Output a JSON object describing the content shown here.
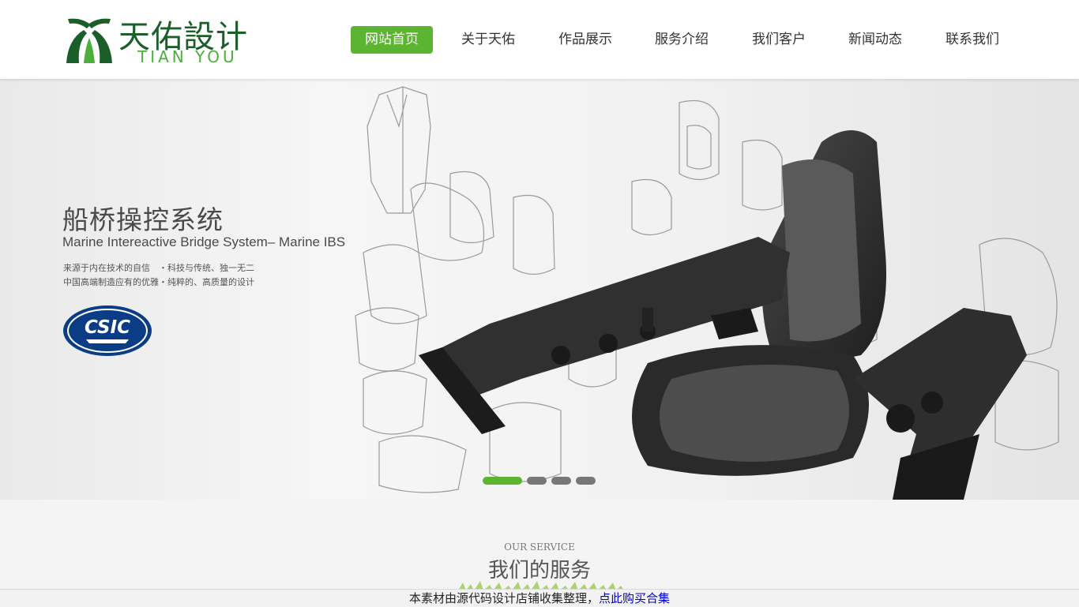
{
  "header": {
    "logo": {
      "cn": "天佑設计",
      "en": "TIAN YOU"
    },
    "nav": [
      {
        "label": "网站首页",
        "active": true
      },
      {
        "label": "关于天佑",
        "active": false
      },
      {
        "label": "作品展示",
        "active": false
      },
      {
        "label": "服务介绍",
        "active": false
      },
      {
        "label": "我们客户",
        "active": false
      },
      {
        "label": "新闻动态",
        "active": false
      },
      {
        "label": "联系我们",
        "active": false
      }
    ]
  },
  "banner": {
    "title": "船桥操控系统",
    "subtitle": "Marine Intereactive Bridge System– Marine IBS",
    "line1": "来源于内在技术的自信　・科技与传统、独一无二",
    "line2": "中国高端制造应有的优雅・纯粹的、高质量的设计",
    "badge_text": "CSIC",
    "slides": {
      "count": 4,
      "active": 0
    }
  },
  "service": {
    "en": "OUR SERVICE",
    "cn": "我们的服务"
  },
  "notice": {
    "text": "本素材由源代码设计店铺收集整理，",
    "link": "点此购买合集"
  },
  "colors": {
    "accent": "#5cb531",
    "logo_dark": "#1b5e2a",
    "link": "#0000cc"
  }
}
